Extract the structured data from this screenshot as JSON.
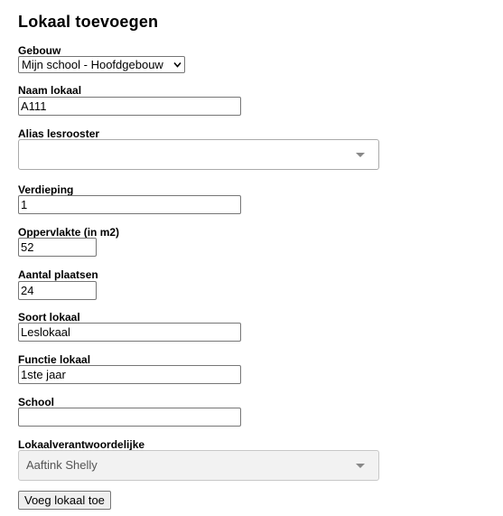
{
  "page": {
    "title": "Lokaal toevoegen"
  },
  "form": {
    "gebouw": {
      "label": "Gebouw",
      "value": "Mijn school - Hoofdgebouw"
    },
    "naam_lokaal": {
      "label": "Naam lokaal",
      "value": "A111"
    },
    "alias_lesrooster": {
      "label": "Alias lesrooster",
      "value": ""
    },
    "verdieping": {
      "label": "Verdieping",
      "value": "1"
    },
    "oppervlakte": {
      "label": "Oppervlakte (in m2)",
      "value": "52"
    },
    "aantal_plaatsen": {
      "label": "Aantal plaatsen",
      "value": "24"
    },
    "soort_lokaal": {
      "label": "Soort lokaal",
      "value": "Leslokaal"
    },
    "functie_lokaal": {
      "label": "Functie lokaal",
      "value": "1ste jaar"
    },
    "school": {
      "label": "School",
      "value": ""
    },
    "lokaalverantwoordelijke": {
      "label": "Lokaalverantwoordelijke",
      "value": "Aaftink Shelly"
    }
  },
  "actions": {
    "submit_label": "Voeg lokaal toe"
  }
}
